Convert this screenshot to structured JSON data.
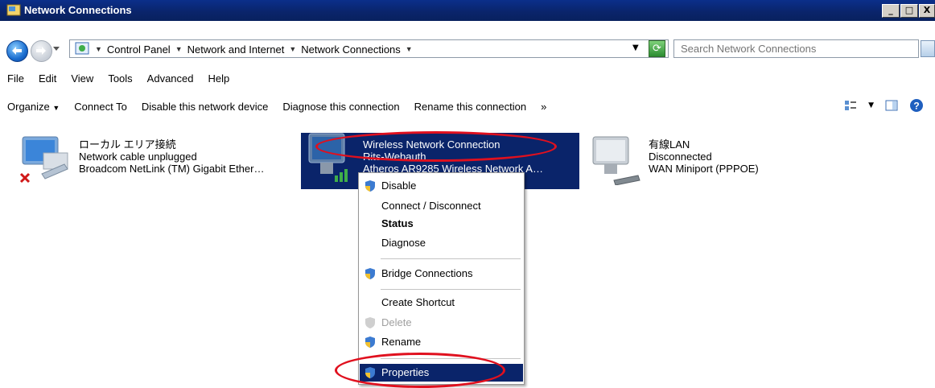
{
  "window": {
    "title": "Network Connections",
    "min_label": "_",
    "max_label": "□",
    "close_label": "X"
  },
  "address": {
    "breadcrumb": [
      "Control Panel",
      "Network and Internet",
      "Network Connections"
    ],
    "search_placeholder": "Search Network Connections"
  },
  "menubar": [
    "File",
    "Edit",
    "View",
    "Tools",
    "Advanced",
    "Help"
  ],
  "commands": {
    "organize": "Organize",
    "connect_to": "Connect To",
    "disable": "Disable this network device",
    "diagnose": "Diagnose this connection",
    "rename": "Rename this connection",
    "more": "»"
  },
  "connections": [
    {
      "name": "ローカル エリア接続",
      "status": "Network cable unplugged",
      "device": "Broadcom NetLink (TM) Gigabit Ether…"
    },
    {
      "name": "Wireless Network Connection",
      "status": "Rits-Webauth",
      "device": "Atheros AR9285 Wireless Network A…"
    },
    {
      "name": "有線LAN",
      "status": "Disconnected",
      "device": "WAN Miniport (PPPOE)"
    }
  ],
  "context_menu": {
    "disable": "Disable",
    "connect": "Connect / Disconnect",
    "status": "Status",
    "diagnose": "Diagnose",
    "bridge": "Bridge Connections",
    "shortcut": "Create Shortcut",
    "delete": "Delete",
    "rename": "Rename",
    "properties": "Properties"
  },
  "colors": {
    "titlebar": "#0a246a",
    "selection": "#0a246a",
    "annotation": "#e0101e"
  }
}
